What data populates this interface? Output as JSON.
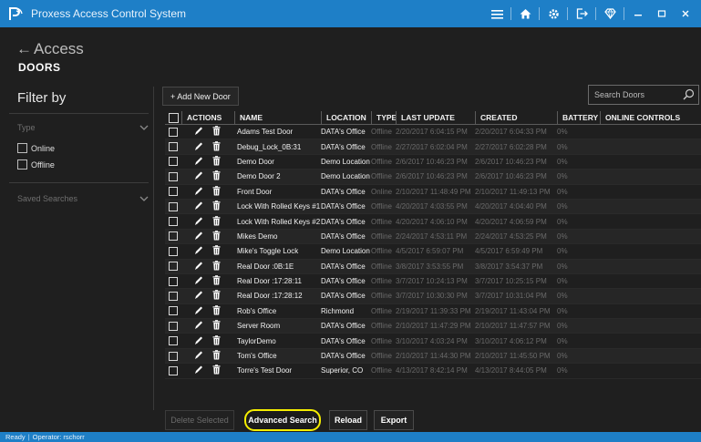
{
  "window": {
    "title": "Proxess Access Control System"
  },
  "header": {
    "back_label": "Access",
    "page_title": "DOORS"
  },
  "sidebar": {
    "filter_title": "Filter by",
    "type_section": "Type",
    "options": [
      "Online",
      "Offline"
    ],
    "saved_searches": "Saved Searches"
  },
  "toolbar": {
    "add_button": "+ Add New Door",
    "search_placeholder": "Search Doors"
  },
  "table": {
    "headers": {
      "actions": "ACTIONS",
      "name": "NAME",
      "location": "LOCATION",
      "type": "TYPE",
      "last_update": "LAST UPDATE",
      "created": "CREATED",
      "battery": "BATTERY",
      "online_controls": "ONLINE CONTROLS"
    },
    "rows": [
      {
        "name": "Adams Test Door",
        "location": "DATA's Office",
        "type": "Offline",
        "last_update": "2/20/2017 6:04:15 PM",
        "created": "2/20/2017 6:04:33 PM",
        "battery": "0%"
      },
      {
        "name": "Debug_Lock_0B:31",
        "location": "DATA's Office",
        "type": "Offline",
        "last_update": "2/27/2017 6:02:04 PM",
        "created": "2/27/2017 6:02:28 PM",
        "battery": "0%"
      },
      {
        "name": "Demo Door",
        "location": "Demo Location",
        "type": "Offline",
        "last_update": "2/6/2017 10:46:23 PM",
        "created": "2/6/2017 10:46:23 PM",
        "battery": "0%"
      },
      {
        "name": "Demo Door 2",
        "location": "Demo Location",
        "type": "Offline",
        "last_update": "2/6/2017 10:46:23 PM",
        "created": "2/6/2017 10:46:23 PM",
        "battery": "0%"
      },
      {
        "name": "Front Door",
        "location": "DATA's Office",
        "type": "Online",
        "last_update": "2/10/2017 11:48:49 PM",
        "created": "2/10/2017 11:49:13 PM",
        "battery": "0%"
      },
      {
        "name": "Lock With Rolled Keys #1",
        "location": "DATA's Office",
        "type": "Offline",
        "last_update": "4/20/2017 4:03:55 PM",
        "created": "4/20/2017 4:04:40 PM",
        "battery": "0%"
      },
      {
        "name": "Lock With Rolled Keys #2",
        "location": "DATA's Office",
        "type": "Offline",
        "last_update": "4/20/2017 4:06:10 PM",
        "created": "4/20/2017 4:06:59 PM",
        "battery": "0%"
      },
      {
        "name": "Mikes Demo",
        "location": "DATA's Office",
        "type": "Offline",
        "last_update": "2/24/2017 4:53:11 PM",
        "created": "2/24/2017 4:53:25 PM",
        "battery": "0%"
      },
      {
        "name": "Mike's Toggle Lock",
        "location": "Demo Location",
        "type": "Offline",
        "last_update": "4/5/2017 6:59:07 PM",
        "created": "4/5/2017 6:59:49 PM",
        "battery": "0%"
      },
      {
        "name": "Real Door :0B:1E",
        "location": "DATA's Office",
        "type": "Offline",
        "last_update": "3/8/2017 3:53:55 PM",
        "created": "3/8/2017 3:54:37 PM",
        "battery": "0%"
      },
      {
        "name": "Real Door :17:28:11",
        "location": "DATA's Office",
        "type": "Offline",
        "last_update": "3/7/2017 10:24:13 PM",
        "created": "3/7/2017 10:25:15 PM",
        "battery": "0%"
      },
      {
        "name": "Real Door :17:28:12",
        "location": "DATA's Office",
        "type": "Offline",
        "last_update": "3/7/2017 10:30:30 PM",
        "created": "3/7/2017 10:31:04 PM",
        "battery": "0%"
      },
      {
        "name": "Rob's Office",
        "location": "Richmond",
        "type": "Offline",
        "last_update": "2/19/2017 11:39:33 PM",
        "created": "2/19/2017 11:43:04 PM",
        "battery": "0%"
      },
      {
        "name": "Server Room",
        "location": "DATA's Office",
        "type": "Offline",
        "last_update": "2/10/2017 11:47:29 PM",
        "created": "2/10/2017 11:47:57 PM",
        "battery": "0%"
      },
      {
        "name": "TaylorDemo",
        "location": "DATA's Office",
        "type": "Offline",
        "last_update": "3/10/2017 4:03:24 PM",
        "created": "3/10/2017 4:06:12 PM",
        "battery": "0%"
      },
      {
        "name": "Tom's Office",
        "location": "DATA's Office",
        "type": "Offline",
        "last_update": "2/10/2017 11:44:30 PM",
        "created": "2/10/2017 11:45:50 PM",
        "battery": "0%"
      },
      {
        "name": "Torre's Test Door",
        "location": "Superior, CO",
        "type": "Offline",
        "last_update": "4/13/2017 8:42:14 PM",
        "created": "4/13/2017 8:44:05 PM",
        "battery": "0%"
      }
    ]
  },
  "footer_buttons": {
    "delete_selected": "Delete Selected",
    "advanced_search": "Advanced Search",
    "reload": "Reload",
    "export": "Export"
  },
  "status": {
    "state": "Ready",
    "operator": "Operator: rschorr"
  },
  "colors": {
    "accent": "#1e7fc7",
    "highlight": "#f5ee00",
    "background": "#1f1f1f"
  }
}
